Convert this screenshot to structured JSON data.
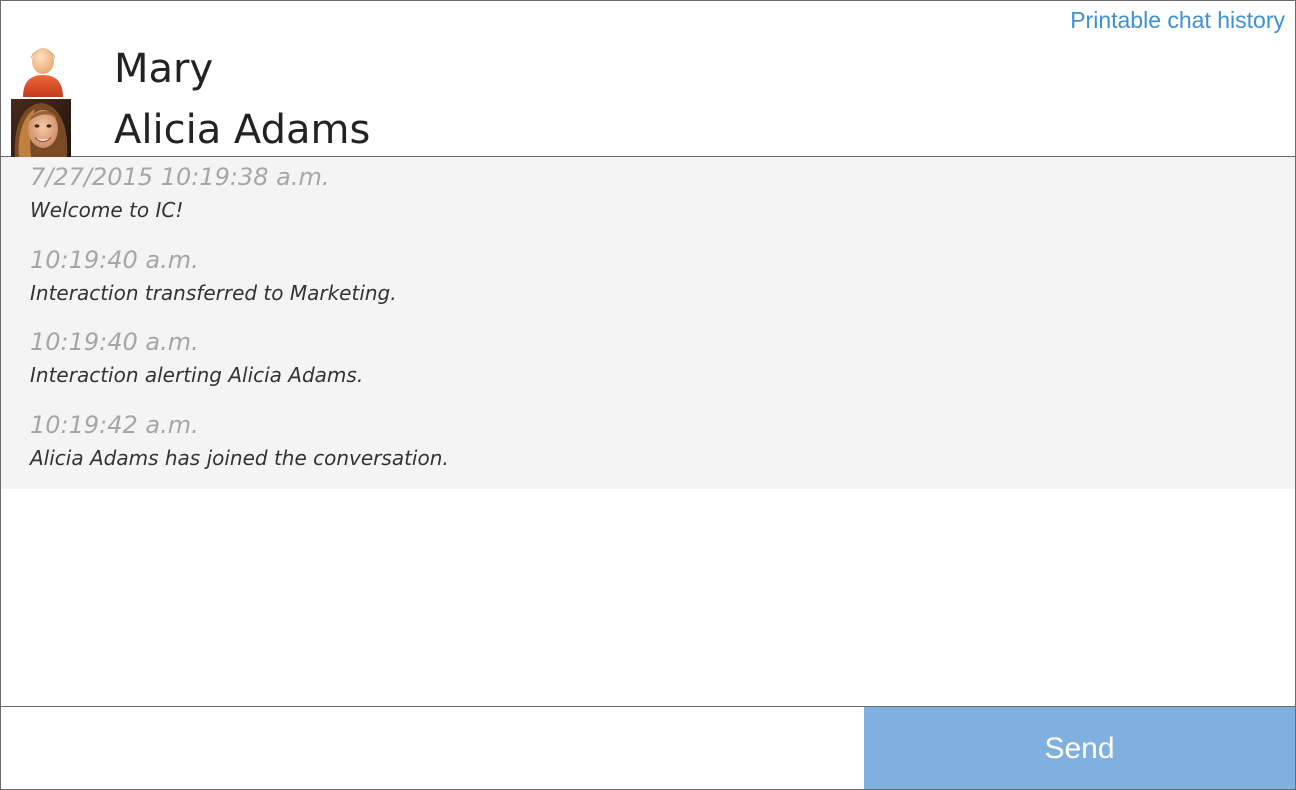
{
  "header": {
    "printable_link": "Printable chat history",
    "participants": [
      {
        "name": "Mary",
        "avatar_icon": "generic-user-icon"
      },
      {
        "name": "Alicia Adams",
        "avatar_icon": "user-photo"
      }
    ]
  },
  "transcript": {
    "entries": [
      {
        "timestamp": "7/27/2015 10:19:38 a.m.",
        "message": "Welcome to IC!"
      },
      {
        "timestamp": "10:19:40 a.m.",
        "message": "Interaction transferred to Marketing."
      },
      {
        "timestamp": "10:19:40 a.m.",
        "message": "Interaction alerting Alicia Adams."
      },
      {
        "timestamp": "10:19:42 a.m.",
        "message": "Alicia Adams has joined the conversation."
      }
    ]
  },
  "composer": {
    "input_value": "",
    "input_placeholder": "",
    "send_label": "Send"
  },
  "colors": {
    "link": "#3f8fd4",
    "send_button": "#80b0de",
    "transcript_background": "#f4f4f4",
    "timestamp_text": "#a6a6a6"
  }
}
